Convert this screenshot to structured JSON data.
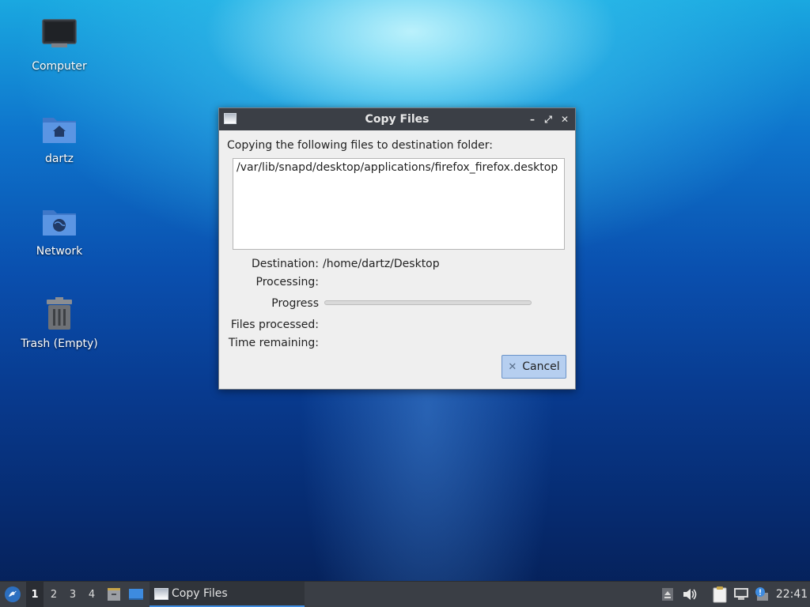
{
  "desktop": {
    "icons": [
      {
        "label": "Computer",
        "icon": "computer-icon"
      },
      {
        "label": "dartz",
        "icon": "home-folder-icon"
      },
      {
        "label": "Network",
        "icon": "network-folder-icon"
      },
      {
        "label": "Trash (Empty)",
        "icon": "trash-icon"
      }
    ]
  },
  "dialog": {
    "title": "Copy Files",
    "heading": "Copying the following files to destination folder:",
    "files": [
      "/var/lib/snapd/desktop/applications/firefox_firefox.desktop"
    ],
    "destination_label": "Destination:",
    "destination_value": "/home/dartz/Desktop",
    "processing_label": "Processing:",
    "processing_value": "",
    "progress_label": "Progress",
    "progress_fraction": 0,
    "files_processed_label": "Files processed:",
    "files_processed_value": "",
    "time_remaining_label": "Time remaining:",
    "time_remaining_value": "",
    "cancel_label": "Cancel",
    "title_buttons": {
      "minimize": "minimize-icon",
      "maximize": "maximize-icon",
      "close": "close-icon"
    }
  },
  "taskbar": {
    "menu_icon": "start-menu-icon",
    "workspaces": [
      "1",
      "2",
      "3",
      "4"
    ],
    "active_workspace": "1",
    "launchers": [
      "file-manager-icon",
      "show-desktop-icon"
    ],
    "tasks": [
      {
        "label": "Copy Files",
        "icon": "window-icon",
        "active": true
      }
    ],
    "tray_icons": [
      "eject-icon",
      "volume-icon",
      "clipboard-icon",
      "network-icon",
      "update-notifier-icon"
    ],
    "clock": "22:41"
  },
  "colors": {
    "titlebar": "#3b3f46",
    "dialog_bg": "#efefef",
    "cancel_button": "#b6cff0",
    "taskbar": "#3a3e45",
    "task_underline": "#3d8be0"
  }
}
